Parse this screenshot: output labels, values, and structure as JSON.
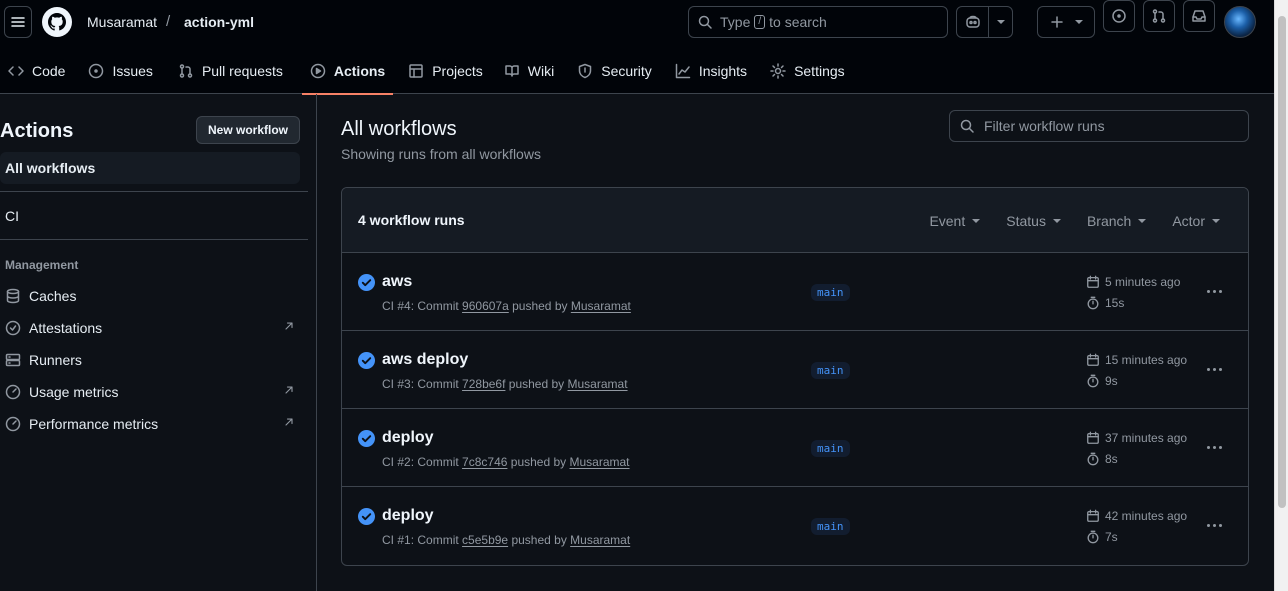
{
  "header": {
    "owner": "Musaramat",
    "separator": "/",
    "repo": "action-yml",
    "search": {
      "prefix": "Type",
      "key": "/",
      "suffix": "to search"
    }
  },
  "tabs": [
    {
      "label": "Code",
      "icon": "code-icon"
    },
    {
      "label": "Issues",
      "icon": "issue-opened-icon"
    },
    {
      "label": "Pull requests",
      "icon": "git-pull-request-icon"
    },
    {
      "label": "Actions",
      "icon": "play-icon",
      "selected": true
    },
    {
      "label": "Projects",
      "icon": "table-icon"
    },
    {
      "label": "Wiki",
      "icon": "book-icon"
    },
    {
      "label": "Security",
      "icon": "shield-icon"
    },
    {
      "label": "Insights",
      "icon": "graph-icon"
    },
    {
      "label": "Settings",
      "icon": "gear-icon"
    }
  ],
  "sidebar": {
    "title": "Actions",
    "new_workflow": "New workflow",
    "all_workflows": "All workflows",
    "workflows": [
      "CI"
    ],
    "management_label": "Management",
    "management": [
      {
        "label": "Caches",
        "icon": "database-icon",
        "external": false
      },
      {
        "label": "Attestations",
        "icon": "verified-icon",
        "external": true
      },
      {
        "label": "Runners",
        "icon": "server-icon",
        "external": false
      },
      {
        "label": "Usage metrics",
        "icon": "meter-icon",
        "external": true
      },
      {
        "label": "Performance metrics",
        "icon": "meter-icon",
        "external": true
      }
    ]
  },
  "main": {
    "title": "All workflows",
    "subtitle": "Showing runs from all workflows",
    "filter_placeholder": "Filter workflow runs",
    "runs_count": "4 workflow runs",
    "filters": [
      "Event",
      "Status",
      "Branch",
      "Actor"
    ],
    "runs": [
      {
        "title": "aws",
        "workflow": "CI #4",
        "commit": "960607a",
        "actor": "Musaramat",
        "branch": "main",
        "when": "5 minutes ago",
        "duration": "15s"
      },
      {
        "title": "aws deploy",
        "workflow": "CI #3",
        "commit": "728be6f",
        "actor": "Musaramat",
        "branch": "main",
        "when": "15 minutes ago",
        "duration": "9s"
      },
      {
        "title": "deploy",
        "workflow": "CI #2",
        "commit": "7c8c746",
        "actor": "Musaramat",
        "branch": "main",
        "when": "37 minutes ago",
        "duration": "8s"
      },
      {
        "title": "deploy",
        "workflow": "CI #1",
        "commit": "c5e5b9e",
        "actor": "Musaramat",
        "branch": "main",
        "when": "42 minutes ago",
        "duration": "7s"
      }
    ],
    "meta_words": {
      "commit": "Commit",
      "pushed_by": "pushed by"
    }
  },
  "colors": {
    "accent": "#f78166",
    "success": "#4493f8",
    "link": "#4493f8",
    "bg": "#0d1117"
  }
}
